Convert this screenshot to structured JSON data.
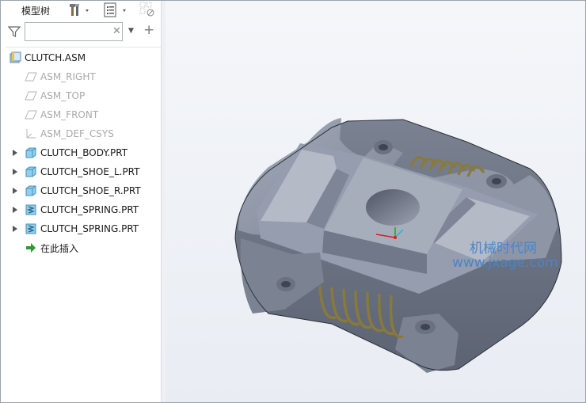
{
  "panel": {
    "title": "模型树",
    "toolbar": [
      {
        "name": "settings-tools-icon"
      },
      {
        "name": "show-list-icon"
      },
      {
        "name": "filter-columns-icon"
      }
    ],
    "search": {
      "value": "",
      "placeholder": ""
    }
  },
  "tree": {
    "root": {
      "label": "CLUTCH.ASM",
      "icon": "assembly-icon"
    },
    "items": [
      {
        "label": "ASM_RIGHT",
        "icon": "datum-plane-icon",
        "expandable": false,
        "dimmed": true
      },
      {
        "label": "ASM_TOP",
        "icon": "datum-plane-icon",
        "expandable": false,
        "dimmed": true
      },
      {
        "label": "ASM_FRONT",
        "icon": "datum-plane-icon",
        "expandable": false,
        "dimmed": true
      },
      {
        "label": "ASM_DEF_CSYS",
        "icon": "coordinate-system-icon",
        "expandable": false,
        "dimmed": true
      },
      {
        "label": "CLUTCH_BODY.PRT",
        "icon": "part-icon",
        "expandable": true,
        "dimmed": false
      },
      {
        "label": "CLUTCH_SHOE_L.PRT",
        "icon": "part-icon",
        "expandable": true,
        "dimmed": false
      },
      {
        "label": "CLUTCH_SHOE_R.PRT",
        "icon": "part-icon",
        "expandable": true,
        "dimmed": false
      },
      {
        "label": "CLUTCH_SPRING.PRT",
        "icon": "spring-part-icon",
        "expandable": true,
        "dimmed": false
      },
      {
        "label": "CLUTCH_SPRING.PRT",
        "icon": "spring-part-icon",
        "expandable": true,
        "dimmed": false
      }
    ],
    "insert_here": {
      "label": "在此插入",
      "icon": "insert-arrow-icon"
    }
  },
  "viewport": {
    "watermark_line1": "机械时代网",
    "watermark_line2": "www.jxage.com",
    "colors": {
      "body": "#8e96a6",
      "body_dark": "#5d6474",
      "spring": "#8a7a3a",
      "accent": "#4a84c9"
    }
  }
}
